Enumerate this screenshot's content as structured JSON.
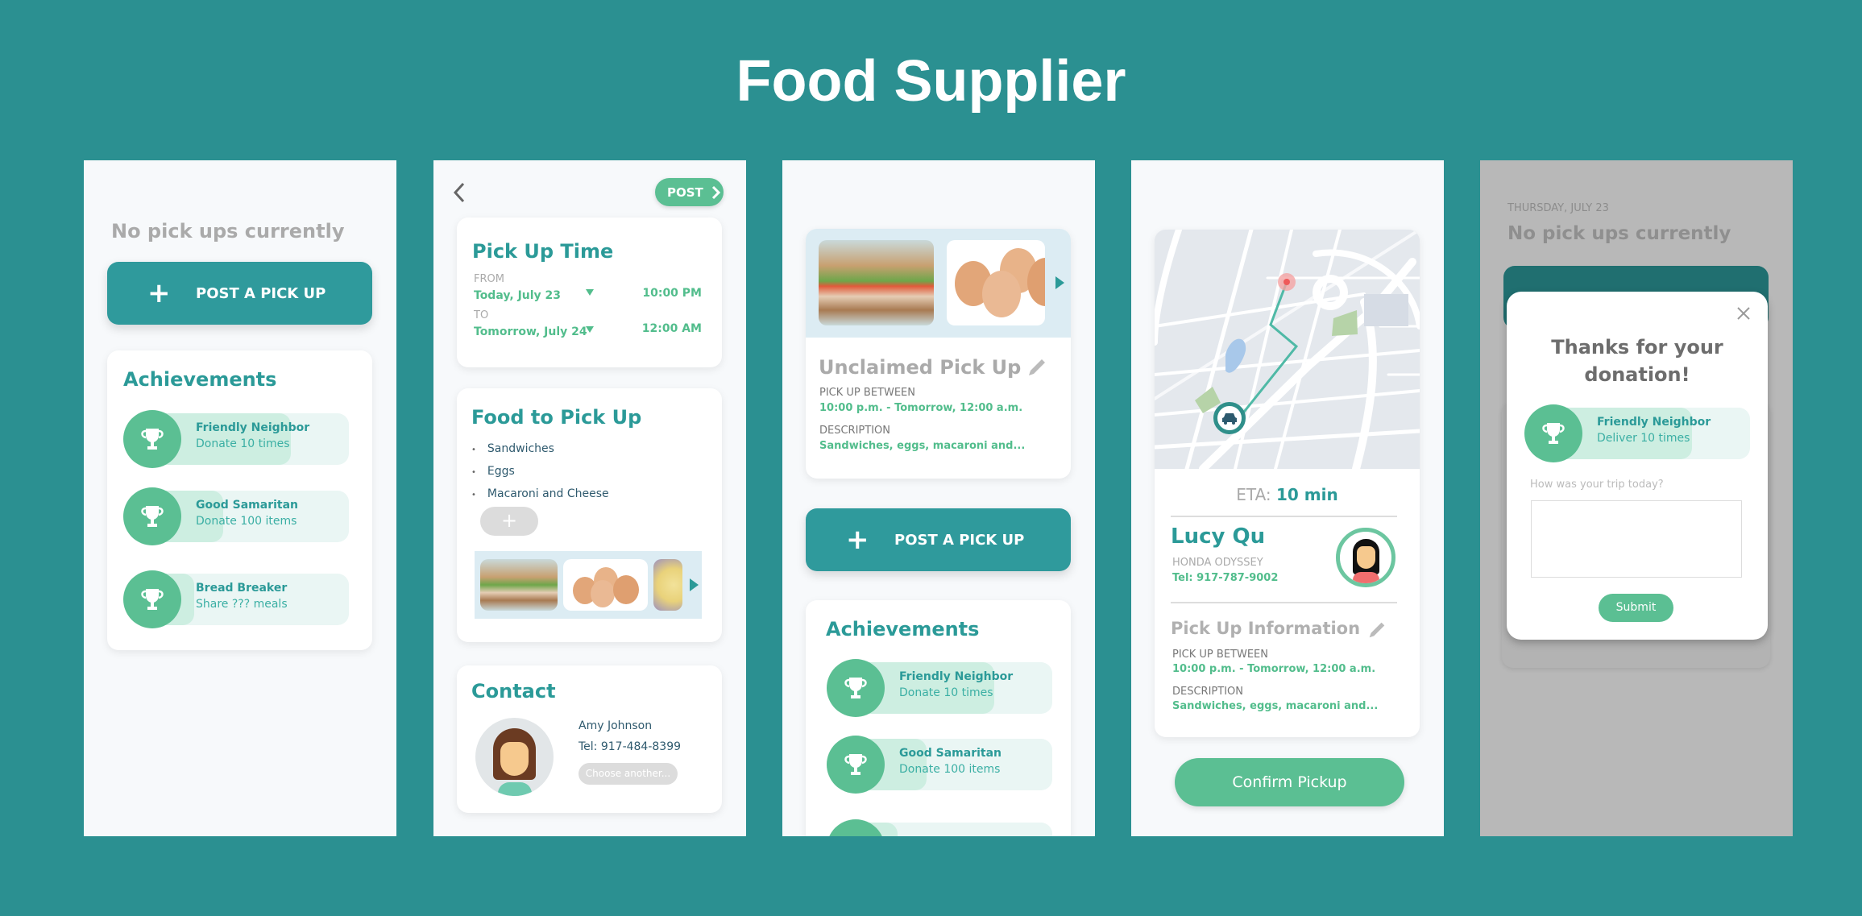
{
  "page_title": "Food Supplier",
  "colors": {
    "background": "#2b9091",
    "teal": "#2f9a9c",
    "green": "#5bbf93",
    "grey_overlay": "#b8b8b8"
  },
  "screen1": {
    "empty_message": "No pick ups currently",
    "post_button": {
      "icon": "plus-icon",
      "label": "POST A PICK UP"
    },
    "achievements": {
      "title": "Achievements",
      "items": [
        {
          "icon": "trophy-icon",
          "name": "Friendly Neighbor",
          "desc": "Donate 10 times",
          "progress": 0.7
        },
        {
          "icon": "trophy-icon",
          "name": "Good Samaritan",
          "desc": "Donate 100 items",
          "progress": 0.35
        },
        {
          "icon": "trophy-icon",
          "name": "Bread Breaker",
          "desc": "Share ??? meals",
          "progress": 0.2
        }
      ]
    }
  },
  "screen2": {
    "back_icon": "chevron-left-icon",
    "post_button": {
      "label": "POST",
      "icon": "chevron-right-icon"
    },
    "pickup_time": {
      "title": "Pick Up Time",
      "from_label": "FROM",
      "from_date": "Today, July 23",
      "from_time": "10:00 PM",
      "to_label": "TO",
      "to_date": "Tomorrow, July 24",
      "to_time": "12:00 AM"
    },
    "food": {
      "title": "Food to Pick Up",
      "items": [
        "Sandwiches",
        "Eggs",
        "Macaroni and Cheese"
      ],
      "add_icon": "plus-icon",
      "images": [
        "sandwich",
        "eggs",
        "macaroni"
      ]
    },
    "contact": {
      "title": "Contact",
      "name": "Amy Johnson",
      "phone": "Tel: 917-484-8399",
      "choose_button": "Choose another..."
    }
  },
  "screen3": {
    "images": [
      "sandwich",
      "eggs"
    ],
    "title": "Unclaimed Pick Up",
    "edit_icon": "pencil-icon",
    "between_label": "PICK UP BETWEEN",
    "between_value": "10:00 p.m. - Tomorrow, 12:00 a.m.",
    "desc_label": "DESCRIPTION",
    "desc_value": "Sandwiches, eggs, macaroni and...",
    "post_button": {
      "icon": "plus-icon",
      "label": "POST A PICK UP"
    },
    "achievements": {
      "title": "Achievements",
      "items": [
        {
          "icon": "trophy-icon",
          "name": "Friendly Neighbor",
          "desc": "Donate 10 times",
          "progress": 0.7
        },
        {
          "icon": "trophy-icon",
          "name": "Good Samaritan",
          "desc": "Donate 100 items",
          "progress": 0.35
        },
        {
          "icon": "trophy-icon",
          "name": "",
          "desc": "",
          "progress": 0.2
        }
      ]
    }
  },
  "screen4": {
    "eta_label": "ETA:",
    "eta_value": "10 min",
    "driver_name": "Lucy Qu",
    "vehicle": "HONDA ODYSSEY",
    "phone": "Tel: 917-787-9002",
    "info_title": "Pick Up Information",
    "edit_icon": "pencil-icon",
    "between_label": "PICK UP BETWEEN",
    "between_value": "10:00 p.m. - Tomorrow, 12:00 a.m.",
    "desc_label": "DESCRIPTION",
    "desc_value": "Sandwiches, eggs, macaroni and...",
    "confirm_button": "Confirm Pickup"
  },
  "screen5": {
    "date": "THURSDAY, JULY 23",
    "empty_message": "No pick ups currently",
    "modal": {
      "close_icon": "close-icon",
      "title_line1": "Thanks for your",
      "title_line2": "donation!",
      "achievement": {
        "icon": "trophy-icon",
        "name": "Friendly Neighbor",
        "desc": "Deliver 10 times",
        "progress": 0.7
      },
      "feedback_label": "How was your trip today?",
      "feedback_value": "",
      "submit_button": "Submit"
    }
  }
}
